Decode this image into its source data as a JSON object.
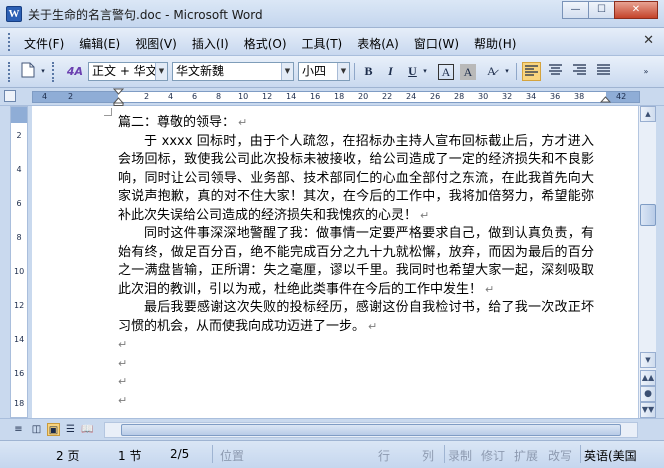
{
  "window": {
    "title": "关于生命的名言警句.doc - Microsoft Word",
    "app_icon_letter": "W",
    "minimize": "—",
    "maximize": "☐",
    "close": "✕"
  },
  "menu": {
    "items": [
      "文件(F)",
      "编辑(E)",
      "视图(V)",
      "插入(I)",
      "格式(O)",
      "工具(T)",
      "表格(A)",
      "窗口(W)",
      "帮助(H)"
    ],
    "close_doc": "✕"
  },
  "toolbar": {
    "style_glyph": "4A",
    "style_value": "正文 + 华文",
    "font_value": "华文新魏",
    "size_value": "小四",
    "bold": "B",
    "italic": "I",
    "underline": "U",
    "char_border": "A",
    "char_shading": "A",
    "more": "A̷"
  },
  "ruler": {
    "numbers": [
      "4",
      "2",
      "2",
      "4",
      "6",
      "8",
      "10",
      "12",
      "14",
      "16",
      "18",
      "20",
      "22",
      "24",
      "26",
      "28",
      "30",
      "32",
      "34",
      "36",
      "38",
      "42"
    ]
  },
  "vruler": {
    "numbers": [
      "2",
      "4",
      "6",
      "8",
      "10",
      "12",
      "14",
      "16",
      "18"
    ]
  },
  "document": {
    "heading": "篇二：尊敬的领导：",
    "para1": "于 xxxx 回标时，由于个人疏忽，在招标办主持人宣布回标截止后，方才进入会场回标，致使我公司此次投标未被接收，给公司造成了一定的经济损失和不良影响，同时让公司领导、业务部、技术部同仁的心血全部付之东流，在此我首先向大家说声抱歉，真的对不住大家！其次，在今后的工作中，我将加倍努力，希望能弥补此次失误给公司造成的经济损失和我愧疚的心灵！",
    "para2": "同时这件事深深地警醒了我：做事情一定要严格要求自己，做到认真负责，有始有终，做足百分百，绝不能完成百分之九十九就松懈，放弃，而因为最后的百分之一满盘皆输，正所谓：失之毫厘，谬以千里。我同时也希望大家一起，深刻吸取此次泪的教训，引以为戒，杜绝此类事件在今后的工作中发生！",
    "para3": "最后我要感谢这次失败的投标经历，感谢这份自我检讨书，给了我一次改正坏习惯的机会，从而使我向成功迈进了一步。",
    "para_mark": "↵"
  },
  "statusbar": {
    "page": "2 页",
    "section": "1 节",
    "page_of": "2/5",
    "position": "位置",
    "line": "行",
    "column": "列",
    "record": "录制",
    "revise": "修订",
    "extend": "扩展",
    "overwrite": "改写",
    "language": "英语(美国"
  }
}
